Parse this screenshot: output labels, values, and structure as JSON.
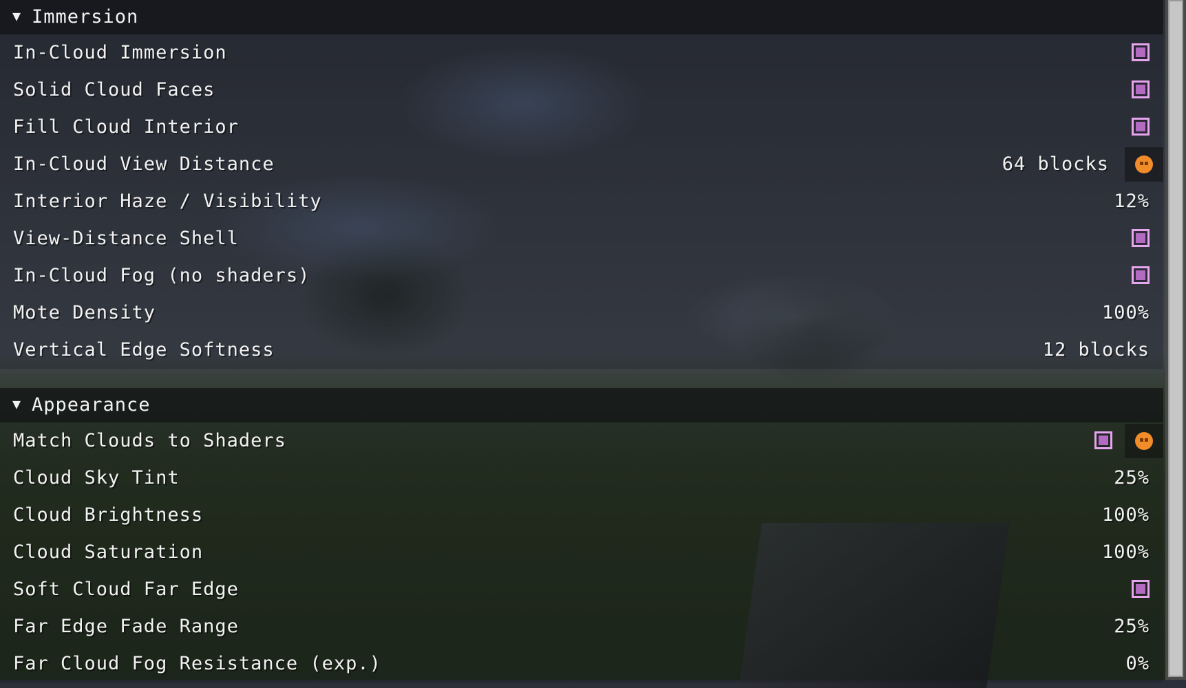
{
  "sections": [
    {
      "title": "Immersion",
      "rows": [
        {
          "label": "In-Cloud Immersion",
          "control": "checkbox",
          "checked": true
        },
        {
          "label": "Solid Cloud Faces",
          "control": "checkbox",
          "checked": true
        },
        {
          "label": "Fill Cloud Interior",
          "control": "checkbox",
          "checked": true
        },
        {
          "label": "In-Cloud View Distance",
          "control": "value",
          "value": "64 blocks",
          "reset": "reset-icon"
        },
        {
          "label": "Interior Haze / Visibility",
          "control": "value",
          "value": "12%"
        },
        {
          "label": "View-Distance Shell",
          "control": "checkbox",
          "checked": true
        },
        {
          "label": "In-Cloud Fog (no shaders)",
          "control": "checkbox",
          "checked": true
        },
        {
          "label": "Mote Density",
          "control": "value",
          "value": "100%"
        },
        {
          "label": "Vertical Edge Softness",
          "control": "value",
          "value": "12 blocks"
        }
      ]
    },
    {
      "title": "Appearance",
      "rows": [
        {
          "label": "Match Clouds to Shaders",
          "control": "checkbox",
          "checked": true,
          "reset": "reset-icon"
        },
        {
          "label": "Cloud Sky Tint",
          "control": "value",
          "value": "25%"
        },
        {
          "label": "Cloud Brightness",
          "control": "value",
          "value": "100%"
        },
        {
          "label": "Cloud Saturation",
          "control": "value",
          "value": "100%"
        },
        {
          "label": "Soft Cloud Far Edge",
          "control": "checkbox",
          "checked": true
        },
        {
          "label": "Far Edge Fade Range",
          "control": "value",
          "value": "25%"
        },
        {
          "label": "Far Cloud Fog Resistance (exp.)",
          "control": "value",
          "value": "0%"
        }
      ]
    }
  ],
  "icons": {
    "collapse": "triangle-down-icon",
    "reset": "reset-icon"
  },
  "colors": {
    "checkbox_border": "#e6a6ee",
    "checkbox_fill": "#b36bc2",
    "reset_icon": "#f08c2a"
  },
  "scrollbar": {
    "visible_fraction": 1.0
  }
}
